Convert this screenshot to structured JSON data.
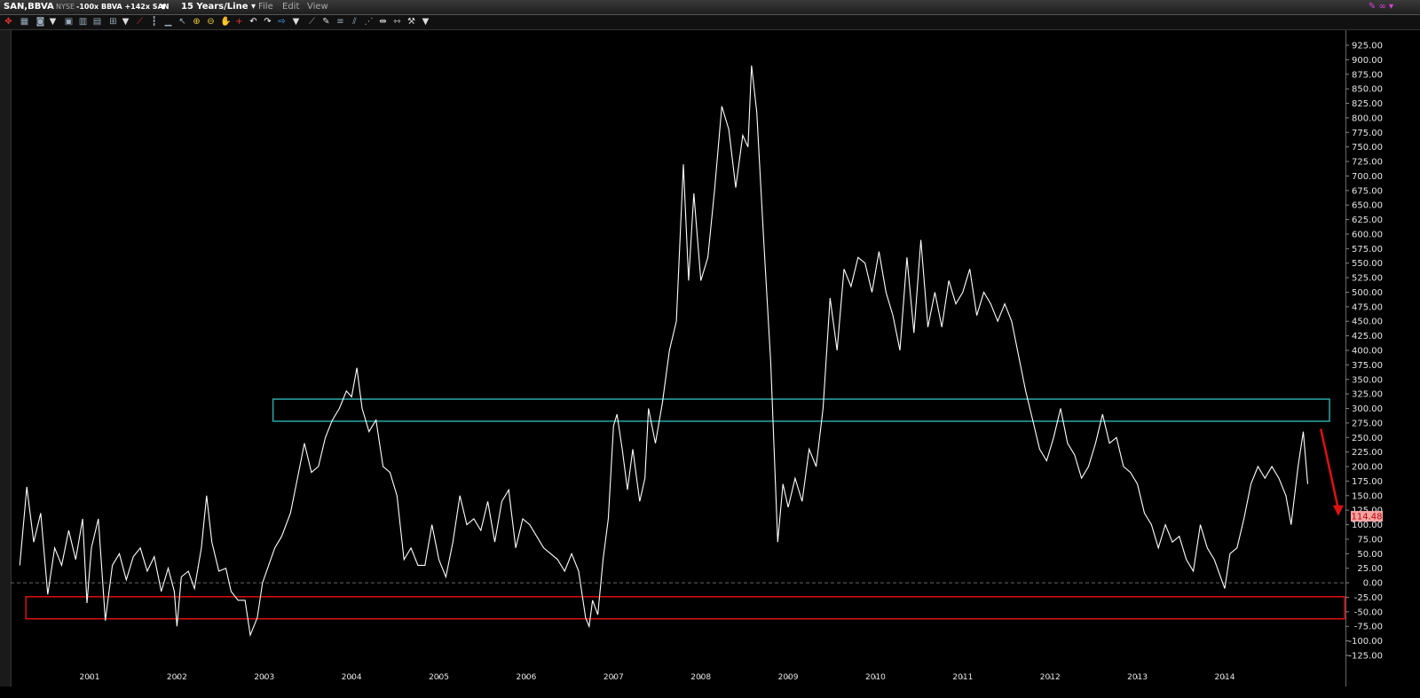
{
  "window": {
    "symbol": "SAN,BBVA",
    "exchange": "NYSE",
    "formula": "-100x BBVA +142x SAN",
    "period": "15 Years/Line",
    "menus": [
      "File",
      "Edit",
      "View"
    ]
  },
  "chart_data": {
    "type": "line",
    "title": "",
    "xlabel": "",
    "ylabel": "",
    "x_tick_labels": [
      "2001",
      "2002",
      "2003",
      "2004",
      "2005",
      "2006",
      "2007",
      "2008",
      "2009",
      "2010",
      "2011",
      "2012",
      "2013",
      "2014"
    ],
    "y_tick_labels": [
      "925.00",
      "900.00",
      "875.00",
      "850.00",
      "825.00",
      "800.00",
      "775.00",
      "750.00",
      "725.00",
      "700.00",
      "675.00",
      "650.00",
      "625.00",
      "600.00",
      "575.00",
      "550.00",
      "525.00",
      "500.00",
      "475.00",
      "450.00",
      "425.00",
      "400.00",
      "375.00",
      "350.00",
      "325.00",
      "300.00",
      "275.00",
      "250.00",
      "225.00",
      "200.00",
      "175.00",
      "150.00",
      "125.00",
      "100.00",
      "75.00",
      "50.00",
      "25.00",
      "0.00",
      "-25.00",
      "-50.00",
      "-75.00",
      "-100.00",
      "-125.00"
    ],
    "ylim": [
      -135,
      940
    ],
    "xlim": [
      2000.15,
      2015.1
    ],
    "last_value_label": "114.48",
    "last_value_color": "#f4a4a4",
    "line_color": "#ffffff",
    "zero_line": 0,
    "series": [
      {
        "values": [
          [
            2000.2,
            30
          ],
          [
            2000.28,
            165
          ],
          [
            2000.36,
            70
          ],
          [
            2000.44,
            120
          ],
          [
            2000.52,
            -20
          ],
          [
            2000.6,
            60
          ],
          [
            2000.68,
            30
          ],
          [
            2000.76,
            90
          ],
          [
            2000.84,
            40
          ],
          [
            2000.92,
            110
          ],
          [
            2000.97,
            -35
          ],
          [
            2001.02,
            60
          ],
          [
            2001.1,
            110
          ],
          [
            2001.18,
            -65
          ],
          [
            2001.26,
            30
          ],
          [
            2001.34,
            50
          ],
          [
            2001.42,
            5
          ],
          [
            2001.5,
            45
          ],
          [
            2001.58,
            60
          ],
          [
            2001.66,
            20
          ],
          [
            2001.74,
            45
          ],
          [
            2001.82,
            -15
          ],
          [
            2001.9,
            25
          ],
          [
            2001.97,
            -15
          ],
          [
            2002.0,
            -75
          ],
          [
            2002.05,
            10
          ],
          [
            2002.13,
            20
          ],
          [
            2002.2,
            -10
          ],
          [
            2002.28,
            60
          ],
          [
            2002.34,
            150
          ],
          [
            2002.4,
            70
          ],
          [
            2002.48,
            20
          ],
          [
            2002.56,
            25
          ],
          [
            2002.62,
            -15
          ],
          [
            2002.7,
            -30
          ],
          [
            2002.78,
            -30
          ],
          [
            2002.84,
            -90
          ],
          [
            2002.92,
            -60
          ],
          [
            2002.98,
            0
          ],
          [
            2003.05,
            30
          ],
          [
            2003.12,
            60
          ],
          [
            2003.2,
            80
          ],
          [
            2003.3,
            120
          ],
          [
            2003.38,
            180
          ],
          [
            2003.46,
            240
          ],
          [
            2003.54,
            190
          ],
          [
            2003.62,
            200
          ],
          [
            2003.7,
            250
          ],
          [
            2003.78,
            280
          ],
          [
            2003.86,
            300
          ],
          [
            2003.94,
            330
          ],
          [
            2004.0,
            320
          ],
          [
            2004.06,
            370
          ],
          [
            2004.12,
            300
          ],
          [
            2004.2,
            260
          ],
          [
            2004.28,
            280
          ],
          [
            2004.36,
            200
          ],
          [
            2004.44,
            190
          ],
          [
            2004.52,
            150
          ],
          [
            2004.6,
            40
          ],
          [
            2004.68,
            60
          ],
          [
            2004.76,
            30
          ],
          [
            2004.84,
            30
          ],
          [
            2004.92,
            100
          ],
          [
            2005.0,
            40
          ],
          [
            2005.08,
            10
          ],
          [
            2005.16,
            70
          ],
          [
            2005.24,
            150
          ],
          [
            2005.32,
            100
          ],
          [
            2005.4,
            110
          ],
          [
            2005.48,
            90
          ],
          [
            2005.56,
            140
          ],
          [
            2005.64,
            70
          ],
          [
            2005.72,
            140
          ],
          [
            2005.8,
            160
          ],
          [
            2005.88,
            60
          ],
          [
            2005.96,
            110
          ],
          [
            2006.04,
            100
          ],
          [
            2006.12,
            80
          ],
          [
            2006.2,
            60
          ],
          [
            2006.28,
            50
          ],
          [
            2006.36,
            40
          ],
          [
            2006.44,
            20
          ],
          [
            2006.52,
            50
          ],
          [
            2006.6,
            20
          ],
          [
            2006.68,
            -60
          ],
          [
            2006.72,
            -75
          ],
          [
            2006.76,
            -30
          ],
          [
            2006.82,
            -55
          ],
          [
            2006.88,
            40
          ],
          [
            2006.94,
            110
          ],
          [
            2007.0,
            270
          ],
          [
            2007.04,
            290
          ],
          [
            2007.1,
            230
          ],
          [
            2007.16,
            160
          ],
          [
            2007.22,
            230
          ],
          [
            2007.3,
            140
          ],
          [
            2007.36,
            180
          ],
          [
            2007.4,
            300
          ],
          [
            2007.48,
            240
          ],
          [
            2007.56,
            310
          ],
          [
            2007.64,
            400
          ],
          [
            2007.72,
            450
          ],
          [
            2007.8,
            720
          ],
          [
            2007.86,
            520
          ],
          [
            2007.92,
            670
          ],
          [
            2008.0,
            520
          ],
          [
            2008.08,
            560
          ],
          [
            2008.16,
            680
          ],
          [
            2008.24,
            820
          ],
          [
            2008.32,
            780
          ],
          [
            2008.4,
            680
          ],
          [
            2008.48,
            770
          ],
          [
            2008.54,
            750
          ],
          [
            2008.58,
            890
          ],
          [
            2008.64,
            810
          ],
          [
            2008.72,
            590
          ],
          [
            2008.8,
            380
          ],
          [
            2008.88,
            70
          ],
          [
            2008.94,
            170
          ],
          [
            2009.0,
            130
          ],
          [
            2009.08,
            180
          ],
          [
            2009.16,
            140
          ],
          [
            2009.24,
            230
          ],
          [
            2009.32,
            200
          ],
          [
            2009.4,
            300
          ],
          [
            2009.48,
            490
          ],
          [
            2009.56,
            400
          ],
          [
            2009.64,
            540
          ],
          [
            2009.72,
            510
          ],
          [
            2009.8,
            560
          ],
          [
            2009.88,
            550
          ],
          [
            2009.96,
            500
          ],
          [
            2010.04,
            570
          ],
          [
            2010.12,
            500
          ],
          [
            2010.2,
            460
          ],
          [
            2010.28,
            400
          ],
          [
            2010.36,
            560
          ],
          [
            2010.44,
            430
          ],
          [
            2010.52,
            590
          ],
          [
            2010.6,
            440
          ],
          [
            2010.68,
            500
          ],
          [
            2010.76,
            440
          ],
          [
            2010.84,
            520
          ],
          [
            2010.92,
            480
          ],
          [
            2011.0,
            500
          ],
          [
            2011.08,
            540
          ],
          [
            2011.16,
            460
          ],
          [
            2011.24,
            500
          ],
          [
            2011.32,
            480
          ],
          [
            2011.4,
            450
          ],
          [
            2011.48,
            480
          ],
          [
            2011.56,
            450
          ],
          [
            2011.64,
            390
          ],
          [
            2011.72,
            330
          ],
          [
            2011.8,
            280
          ],
          [
            2011.88,
            230
          ],
          [
            2011.96,
            210
          ],
          [
            2012.04,
            250
          ],
          [
            2012.12,
            300
          ],
          [
            2012.2,
            240
          ],
          [
            2012.28,
            220
          ],
          [
            2012.36,
            180
          ],
          [
            2012.44,
            200
          ],
          [
            2012.52,
            240
          ],
          [
            2012.6,
            290
          ],
          [
            2012.68,
            240
          ],
          [
            2012.76,
            250
          ],
          [
            2012.84,
            200
          ],
          [
            2012.92,
            190
          ],
          [
            2013.0,
            170
          ],
          [
            2013.08,
            120
          ],
          [
            2013.16,
            100
          ],
          [
            2013.24,
            60
          ],
          [
            2013.32,
            100
          ],
          [
            2013.4,
            70
          ],
          [
            2013.48,
            80
          ],
          [
            2013.56,
            40
          ],
          [
            2013.64,
            20
          ],
          [
            2013.72,
            100
          ],
          [
            2013.8,
            60
          ],
          [
            2013.88,
            40
          ],
          [
            2014.0,
            -10
          ],
          [
            2014.06,
            50
          ],
          [
            2014.14,
            60
          ],
          [
            2014.22,
            110
          ],
          [
            2014.3,
            170
          ],
          [
            2014.38,
            200
          ],
          [
            2014.46,
            180
          ],
          [
            2014.54,
            200
          ],
          [
            2014.62,
            180
          ],
          [
            2014.7,
            150
          ],
          [
            2014.76,
            100
          ],
          [
            2014.84,
            200
          ],
          [
            2014.9,
            260
          ],
          [
            2014.95,
            170
          ]
        ]
      }
    ],
    "annotations": [
      {
        "type": "rect",
        "color": "#2aa8a8",
        "x": [
          2003.1,
          2015.2
        ],
        "y": [
          278,
          316
        ]
      },
      {
        "type": "rect",
        "color": "#e01010",
        "x": [
          2000.27,
          2015.4
        ],
        "y": [
          -62,
          -24
        ]
      },
      {
        "type": "arrow",
        "color": "#e01010",
        "from": [
          2015.1,
          265
        ],
        "to": [
          2015.3,
          115
        ]
      }
    ]
  }
}
